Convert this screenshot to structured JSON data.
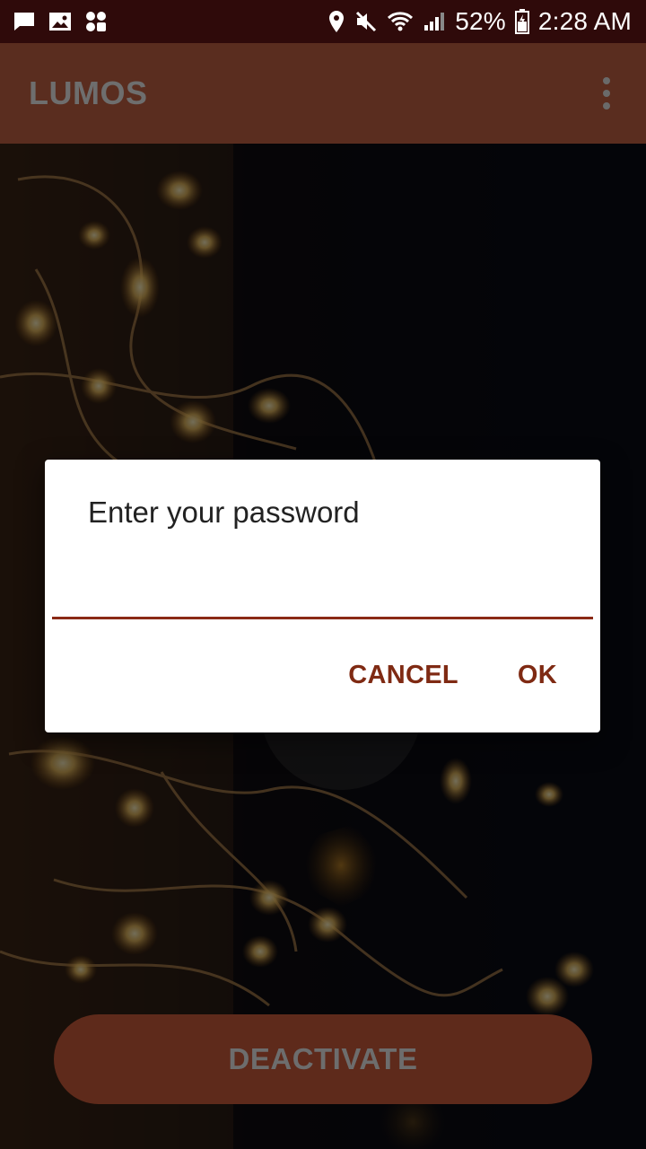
{
  "status_bar": {
    "left_icons": [
      "message-icon",
      "image-icon",
      "app-grid-icon"
    ],
    "right_icons": [
      "location-icon",
      "mute-icon",
      "wifi-icon",
      "signal-icon",
      "battery-icon"
    ],
    "battery": "52%",
    "time": "2:28 AM"
  },
  "app_bar": {
    "title": "LUMOS",
    "menu_icon": "more-vert-icon"
  },
  "dialog": {
    "title": "Enter your password",
    "input_value": "",
    "cancel_label": "CANCEL",
    "ok_label": "OK"
  },
  "main": {
    "deactivate_label": "DEACTIVATE"
  },
  "colors": {
    "status_bar_bg": "#2f0a0a",
    "app_bar_bg": "#5a2d1f",
    "accent": "#7f2a13",
    "button_bg": "#5e2a1b"
  }
}
